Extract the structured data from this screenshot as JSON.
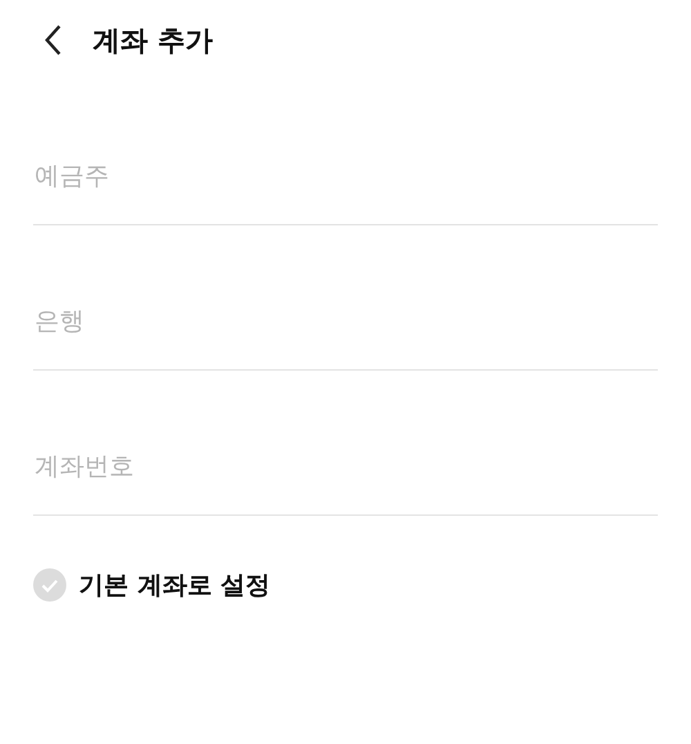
{
  "header": {
    "title": "계좌 추가"
  },
  "fields": [
    {
      "placeholder": "예금주"
    },
    {
      "placeholder": "은행"
    },
    {
      "placeholder": "계좌번호"
    }
  ],
  "default_option": {
    "label": "기본 계좌로 설정",
    "checked": false
  }
}
